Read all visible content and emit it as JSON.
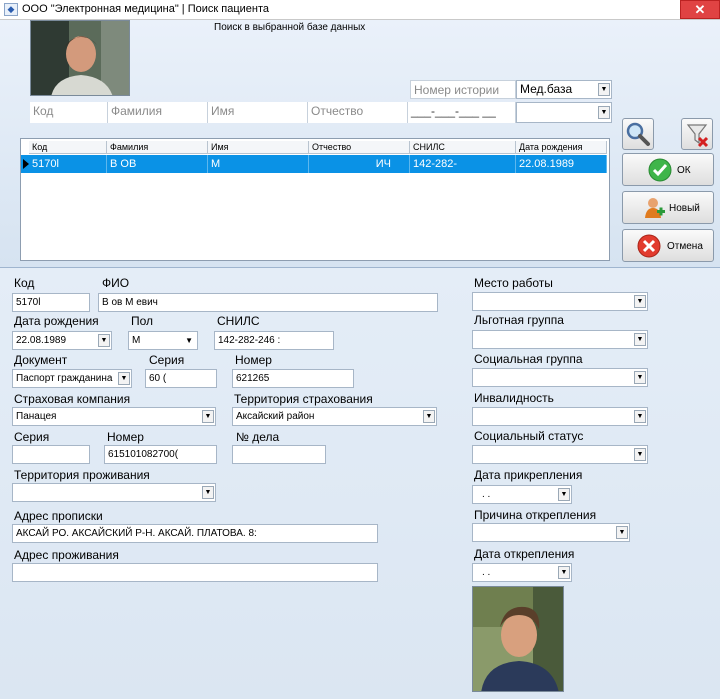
{
  "window": {
    "title": "ООО \"Электронная медицина\" | Поиск пациента",
    "close_label": "✕"
  },
  "search": {
    "caption": "Поиск в выбранной базе данных",
    "history_placeholder": "Номер истории",
    "db_select": "Мед.база",
    "code_placeholder": "Код",
    "lastname_placeholder": "Фамилия",
    "firstname_placeholder": "Имя",
    "patronymic_placeholder": "Отчество",
    "snils_mask": "___-___-___ __"
  },
  "grid": {
    "headers": [
      "Код",
      "Фамилия",
      "Имя",
      "Отчество",
      "СНИЛС",
      "Дата рождения"
    ],
    "row": {
      "code": "5170l",
      "lastname": "В          ОВ",
      "firstname": "М",
      "patronymic": "ИЧ",
      "snils": "142-282-",
      "birthdate": "22.08.1989"
    }
  },
  "buttons": {
    "ok": "ОК",
    "new": "Новый",
    "cancel": "Отмена"
  },
  "form": {
    "code_label": "Код",
    "code_value": "5170l",
    "fio_label": "ФИО",
    "fio_value": "В        ов М                    евич",
    "birth_label": "Дата рождения",
    "birth_value": "22.08.1989",
    "sex_label": "Пол",
    "sex_value": "М",
    "snils_label": "СНИЛС",
    "snils_value": "142-282-246 :",
    "doc_label": "Документ",
    "doc_value": "Паспорт гражданина",
    "series_label": "Серия",
    "series_value": "60 (",
    "number_label": "Номер",
    "number_value": "621265",
    "insurer_label": "Страховая компания",
    "insurer_value": "Панацея",
    "ins_territory_label": "Территория страхования",
    "ins_territory_value": "Аксайский район",
    "pol_series_label": "Серия",
    "pol_series_value": "",
    "pol_number_label": "Номер",
    "pol_number_value": "615101082700(",
    "case_label": "№ дела",
    "case_value": "",
    "res_territory_label": "Территория проживания",
    "res_territory_value": "",
    "reg_address_label": "Адрес прописки",
    "reg_address_value": "АКСАЙ РО. АКСАЙСКИЙ Р-Н. АКСАЙ. ПЛАТОВА. 8:",
    "live_address_label": "Адрес проживания",
    "live_address_value": "",
    "work_label": "Место работы",
    "benefit_label": "Льготная группа",
    "social_group_label": "Социальная группа",
    "disability_label": "Инвалидность",
    "social_status_label": "Социальный статус",
    "attach_date_label": "Дата прикрепления",
    "attach_date_value": ". .",
    "detach_reason_label": "Причина открепления",
    "detach_date_label": "Дата открепления",
    "detach_date_value": ". ."
  }
}
